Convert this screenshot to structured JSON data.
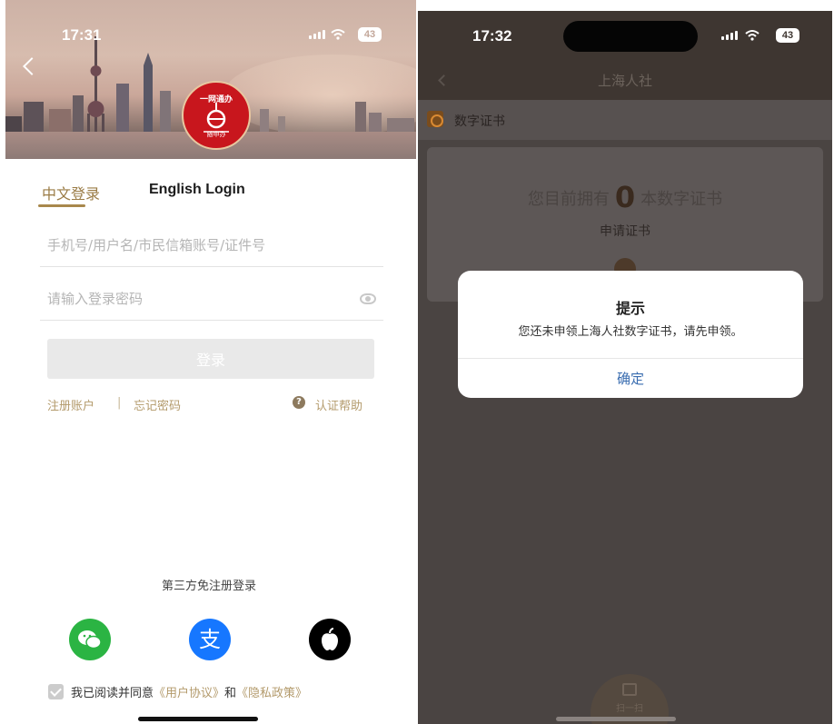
{
  "left_screen": {
    "status": {
      "time": "17:31",
      "battery": "43"
    },
    "logo": {
      "top_text": "一网通办",
      "bottom_text": "随申办"
    },
    "tabs": [
      {
        "label": "中文登录",
        "active": true
      },
      {
        "label": "English Login",
        "active": false
      }
    ],
    "fields": {
      "account_placeholder": "手机号/用户名/市民信箱账号/证件号",
      "password_placeholder": "请输入登录密码"
    },
    "login_button": "登录",
    "links": {
      "register": "注册账户",
      "separator": "|",
      "forgot": "忘记密码",
      "help": "认证帮助"
    },
    "third_party_title": "第三方免注册登录",
    "social_icons": [
      "wechat-icon",
      "alipay-icon",
      "apple-icon"
    ],
    "agreement": {
      "prefix": "我已阅读并同意",
      "user_agreement": "《用户协议》",
      "conjunction": "和",
      "privacy_policy": "《隐私政策》"
    },
    "colors": {
      "accent": "#a8884c",
      "link": "#b39a6b",
      "wechat": "#2bb443",
      "alipay": "#1677ff",
      "apple": "#000000"
    }
  },
  "right_screen": {
    "status": {
      "time": "17:32",
      "battery": "43"
    },
    "nav_title": "上海人社",
    "section_title": "数字证书",
    "card": {
      "own_prefix": "您目前拥有",
      "count": "0",
      "own_suffix": "本数字证书",
      "apply": "申请证书"
    },
    "dialog": {
      "title": "提示",
      "message": "您还未申领上海人社数字证书，请先申领。",
      "confirm": "确定"
    },
    "bottom_scan_label": "扫一扫"
  }
}
